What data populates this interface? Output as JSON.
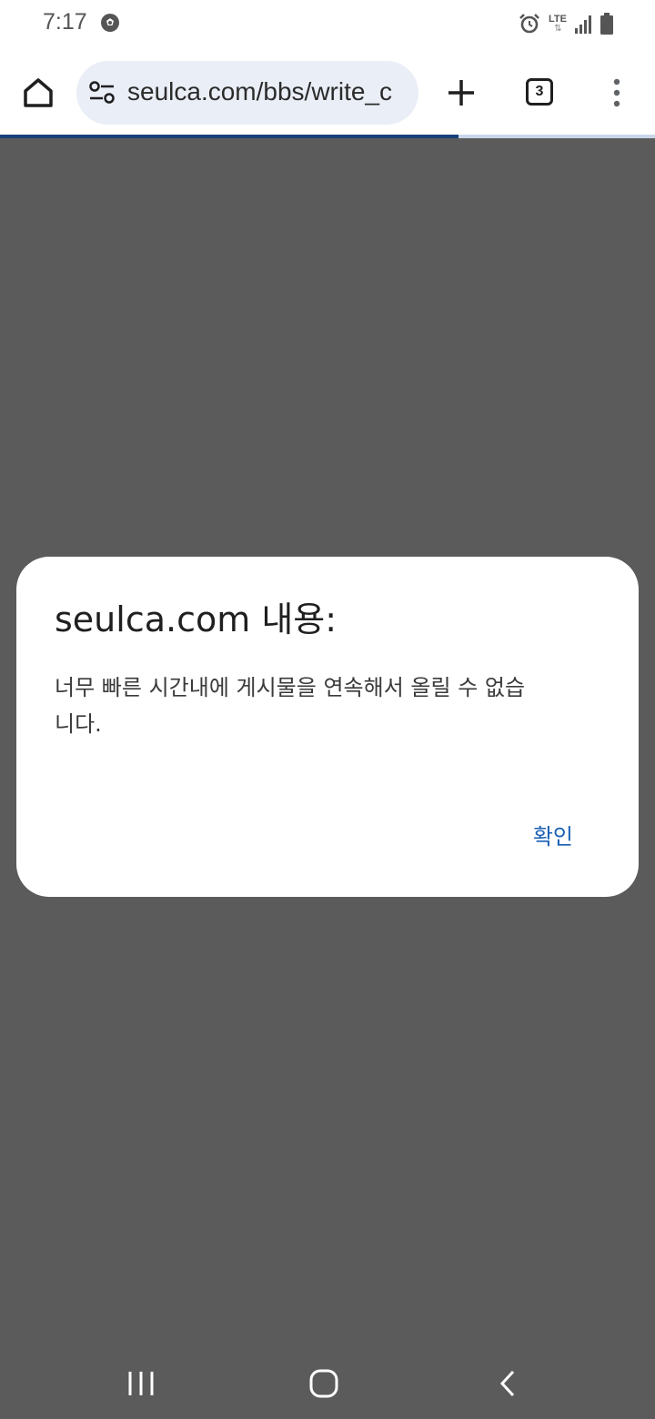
{
  "status_bar": {
    "time": "7:17",
    "ball_icon": "soccer-ball-icon",
    "alarm_icon": "alarm-icon",
    "network_label": "LTE",
    "signal_icon": "signal-bars-icon",
    "battery_icon": "battery-icon"
  },
  "toolbar": {
    "home_icon": "home-icon",
    "url": "seulca.com/bbs/write_c",
    "site_settings_icon": "tune-icon",
    "new_tab_icon": "plus-icon",
    "tab_count": "3",
    "menu_icon": "kebab-menu-icon"
  },
  "progress": {
    "fraction": 0.7
  },
  "dialog": {
    "title": "seulca.com 내용:",
    "message": "너무 빠른 시간내에 게시물을 연속해서 올릴 수 없습니다.",
    "confirm_label": "확인"
  },
  "nav_bar": {
    "recent_icon": "recent-apps-icon",
    "home_icon": "home-circle-icon",
    "back_icon": "back-chevron-icon"
  },
  "colors": {
    "overlay": "#5b5b5b",
    "accent": "#1a5fb4",
    "progress": "#173f7a"
  }
}
